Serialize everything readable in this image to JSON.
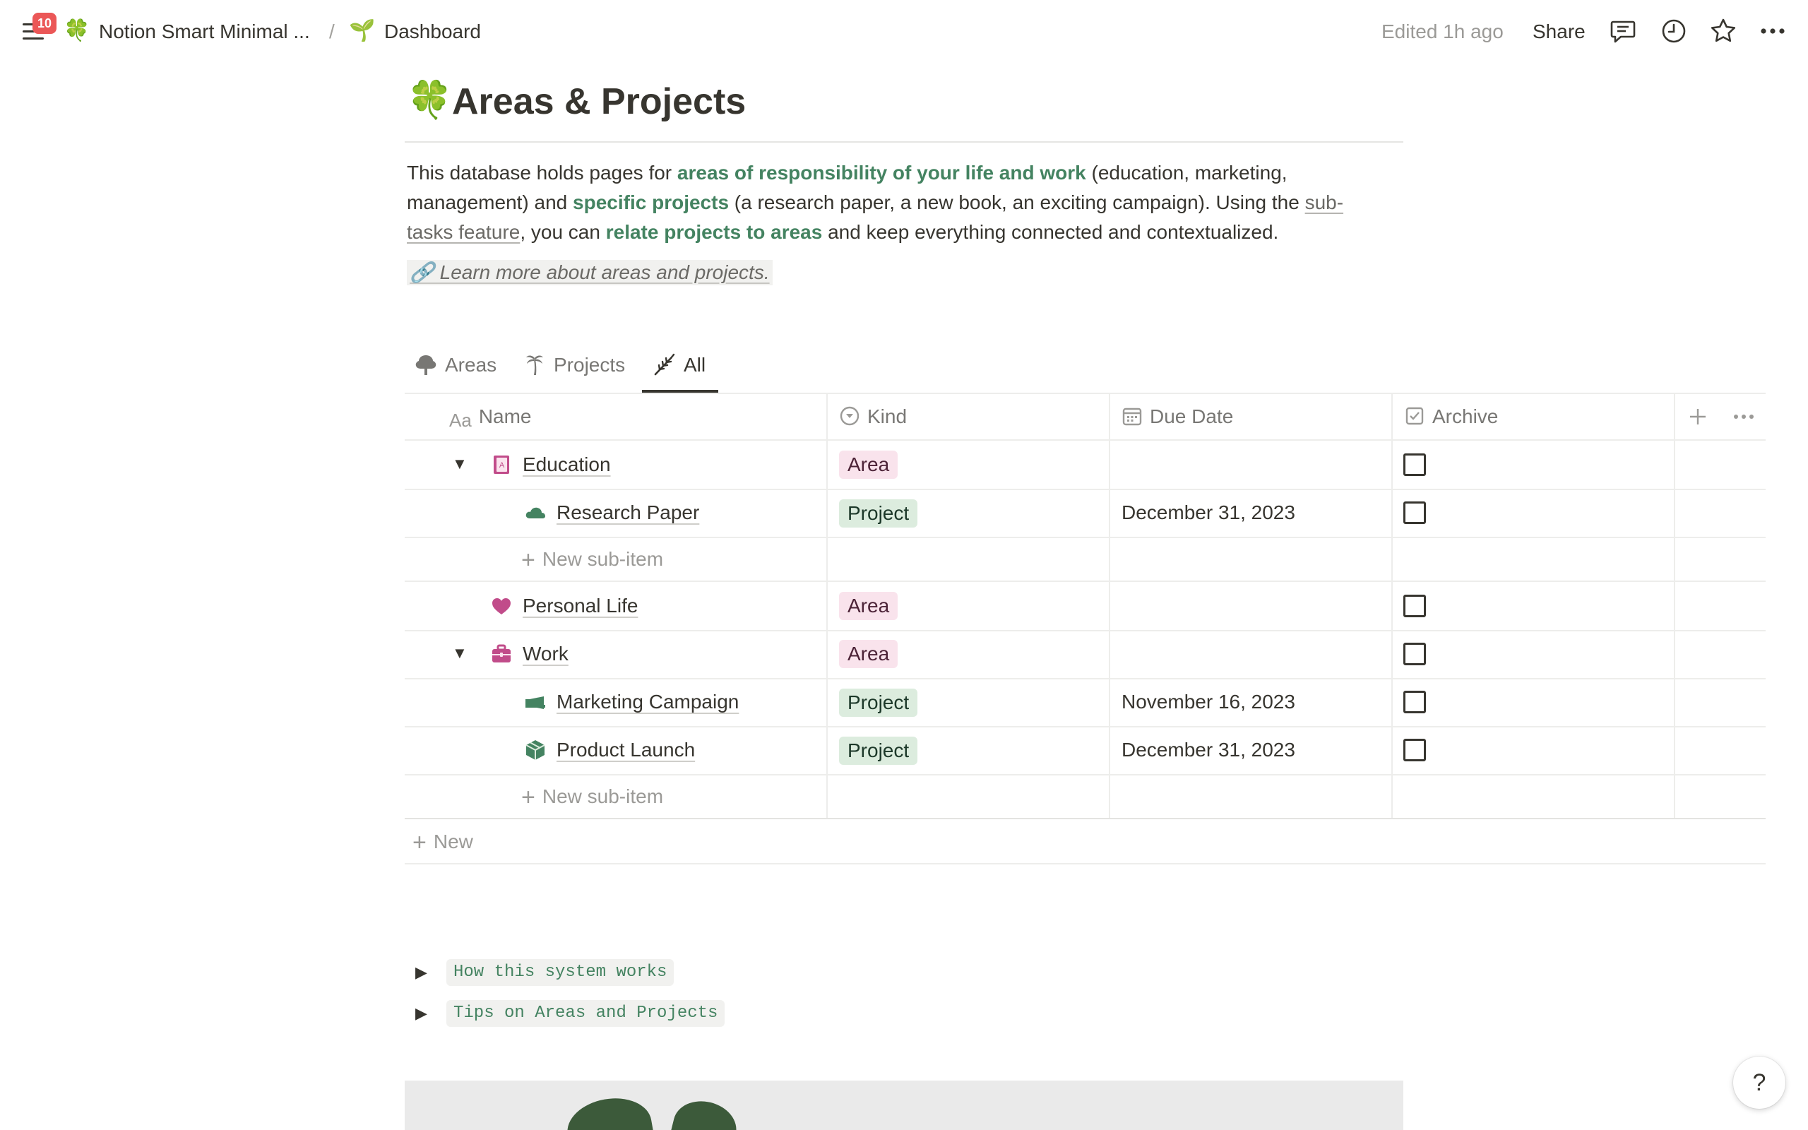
{
  "topbar": {
    "notification_count": "10",
    "workspace_emoji": "🍀",
    "workspace_name": "Notion Smart Minimal ...",
    "separator": "/",
    "page_emoji": "🌱",
    "page_name": "Dashboard",
    "edited": "Edited 1h ago",
    "share_label": "Share",
    "icons": [
      "menu-icon",
      "comment-icon",
      "clock-icon",
      "star-icon",
      "more-icon"
    ]
  },
  "page": {
    "emoji": "🍀",
    "title": "Areas & Projects"
  },
  "description": {
    "l1_a": "This database holds pages for ",
    "l1_link": "areas of responsibility of your life and work",
    "l1_b": " (education, marketing,",
    "l2_a": "management) and ",
    "l2_link": "specific projects",
    "l2_b": " (a research paper, a new book, an exciting campaign). Using the ",
    "l2_ul": "sub-",
    "l3_ul": "tasks feature",
    "l3_a": ", you can ",
    "l3_link": "relate projects to areas",
    "l3_b": " and keep everything connected and contextualized.",
    "learn_more": "🔗 Learn more about areas and projects."
  },
  "tabs": [
    {
      "label": "Areas",
      "icon": "tree-icon"
    },
    {
      "label": "Projects",
      "icon": "palm-icon"
    },
    {
      "label": "All",
      "icon": "wheat-icon",
      "active": true
    }
  ],
  "table": {
    "columns": [
      {
        "label": "Name",
        "icon": "text-type-icon",
        "icon_text": "Aa"
      },
      {
        "label": "Kind",
        "icon": "select-icon"
      },
      {
        "label": "Due Date",
        "icon": "calendar-icon"
      },
      {
        "label": "Archive",
        "icon": "checkbox-icon"
      }
    ],
    "rows": [
      {
        "name": "Education",
        "kind": "Area",
        "due": "",
        "icon": "book-icon",
        "expanded": true
      },
      {
        "name": "Research Paper",
        "kind": "Project",
        "due": "December 31, 2023",
        "icon": "cloud-icon"
      },
      {
        "name": "Personal Life",
        "kind": "Area",
        "due": "",
        "icon": "heart-icon"
      },
      {
        "name": "Work",
        "kind": "Area",
        "due": "",
        "icon": "briefcase-icon",
        "expanded": true
      },
      {
        "name": "Marketing Campaign",
        "kind": "Project",
        "due": "November 16, 2023",
        "icon": "megaphone-icon"
      },
      {
        "name": "Product Launch",
        "kind": "Project",
        "due": "December 31, 2023",
        "icon": "package-icon"
      }
    ],
    "new_sub_item": "New sub-item",
    "new_row": "New"
  },
  "toggles": [
    {
      "label": "How this system works"
    },
    {
      "label": "Tips on Areas and Projects"
    }
  ],
  "help_label": "?",
  "colors": {
    "text": "#37352f",
    "muted": "#787774",
    "green": "#448361",
    "area_tag": "#f9e3ec",
    "project_tag": "#dcecde",
    "pink_icon": "#c14c8a",
    "green_icon": "#448361",
    "badge": "#eb5757"
  }
}
